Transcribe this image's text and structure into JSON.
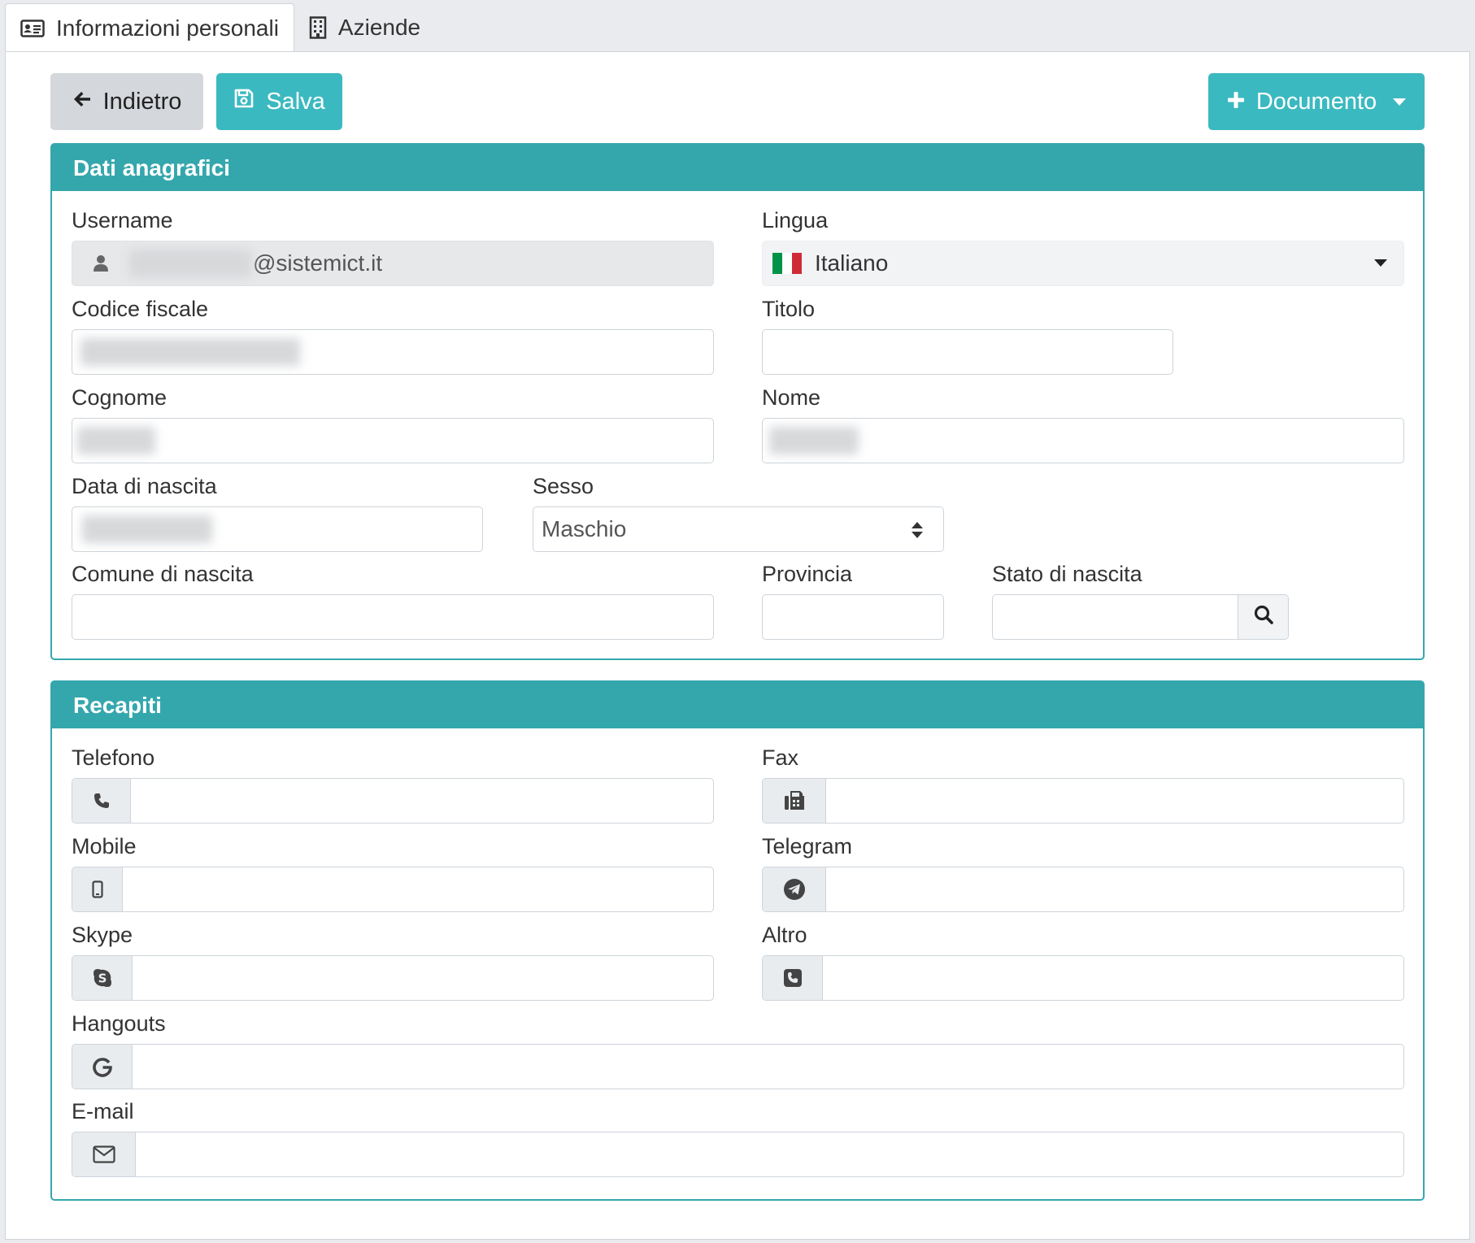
{
  "tabs": [
    {
      "label": "Informazioni personali",
      "icon": "id-card-icon",
      "active": true
    },
    {
      "label": "Aziende",
      "icon": "building-icon",
      "active": false
    }
  ],
  "toolbar": {
    "back_label": "Indietro",
    "save_label": "Salva",
    "document_label": "Documento"
  },
  "colors": {
    "accent": "#34a7ad",
    "button_accent": "#3bb9c0",
    "flag": [
      "#009246",
      "#ffffff",
      "#ce2b37"
    ]
  },
  "personal": {
    "title": "Dati anagrafici",
    "username_label": "Username",
    "username_suffix": "@sistemict.it",
    "language_label": "Lingua",
    "language_value": "Italiano",
    "tax_code_label": "Codice fiscale",
    "title_label": "Titolo",
    "surname_label": "Cognome",
    "name_label": "Nome",
    "birth_date_label": "Data di nascita",
    "sex_label": "Sesso",
    "sex_value": "Maschio",
    "birth_city_label": "Comune di nascita",
    "province_label": "Provincia",
    "birth_country_label": "Stato di nascita"
  },
  "contacts": {
    "title": "Recapiti",
    "phone_label": "Telefono",
    "fax_label": "Fax",
    "mobile_label": "Mobile",
    "telegram_label": "Telegram",
    "skype_label": "Skype",
    "other_label": "Altro",
    "hangouts_label": "Hangouts",
    "email_label": "E-mail"
  }
}
